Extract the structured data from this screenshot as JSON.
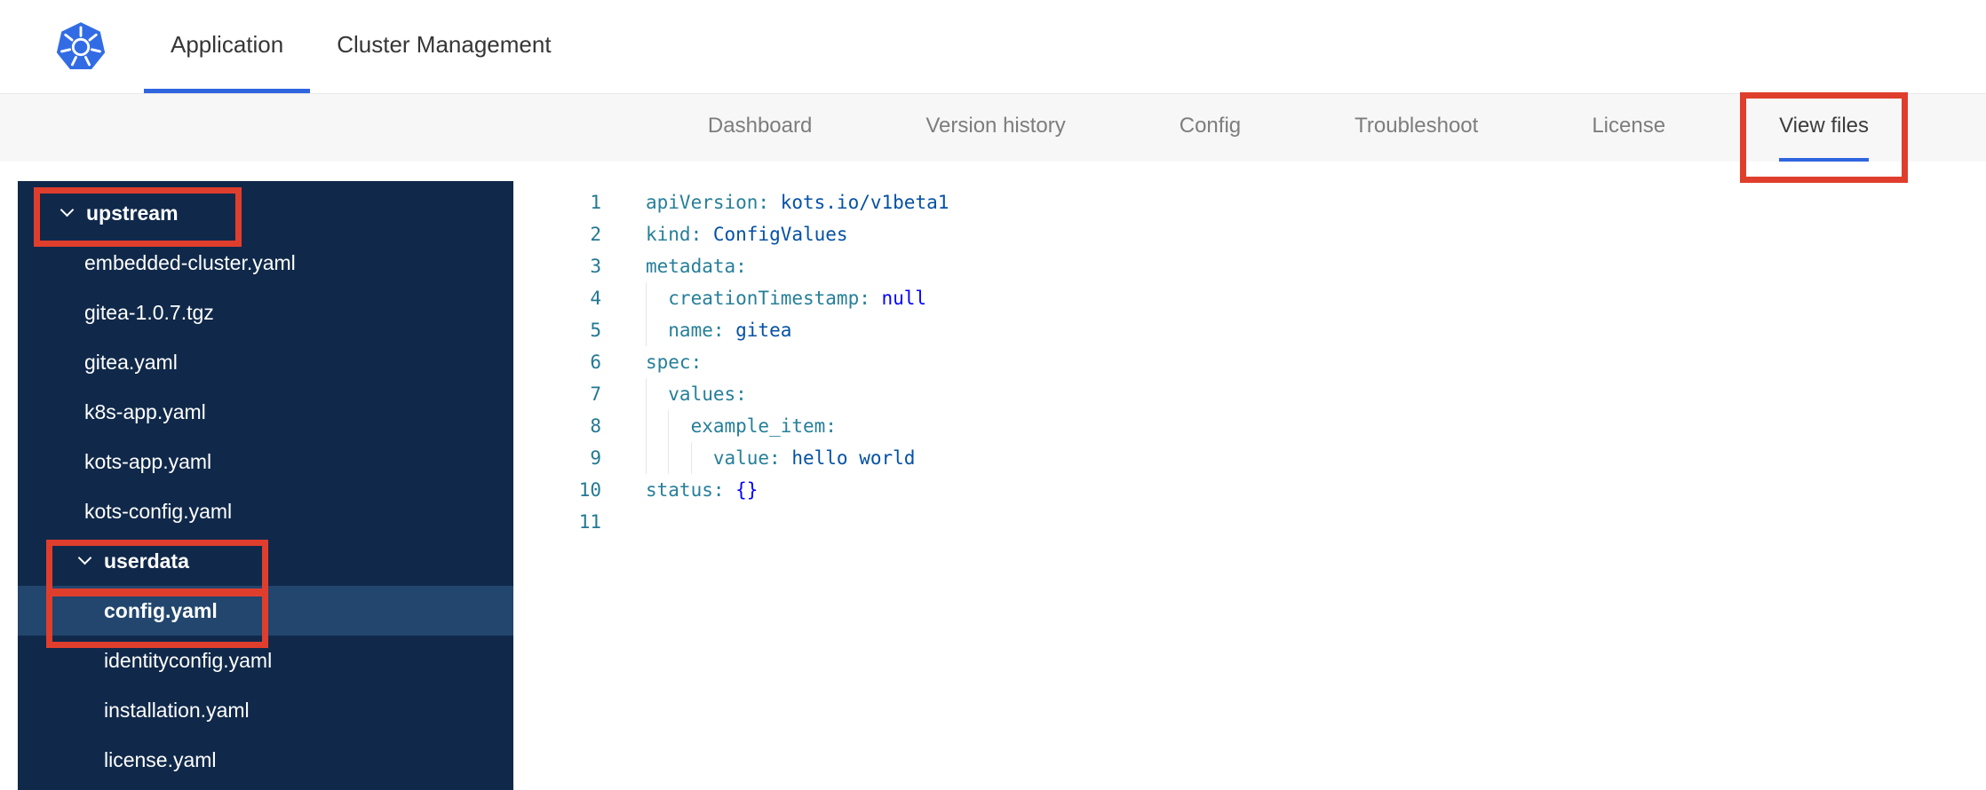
{
  "colors": {
    "annotation_red": "#e03e2d",
    "active_underline_blue": "#3065e0",
    "kubernetes_blue": "#326ce5",
    "sidebar_bg": "#10294a",
    "sidebar_selected_bg": "#22466e",
    "code_key": "#267f99",
    "code_value": "#0451a5",
    "code_keyword": "#0000ff"
  },
  "header": {
    "logo": "kubernetes-logo",
    "tabs": [
      {
        "label": "Application",
        "active": true
      },
      {
        "label": "Cluster Management",
        "active": false
      }
    ]
  },
  "subnav": {
    "items": [
      {
        "label": "Dashboard",
        "active": false,
        "annotated": false
      },
      {
        "label": "Version history",
        "active": false,
        "annotated": false
      },
      {
        "label": "Config",
        "active": false,
        "annotated": false
      },
      {
        "label": "Troubleshoot",
        "active": false,
        "annotated": false
      },
      {
        "label": "License",
        "active": false,
        "annotated": false
      },
      {
        "label": "View files",
        "active": true,
        "annotated": true
      }
    ]
  },
  "file_tree": {
    "items": [
      {
        "type": "folder",
        "label": "upstream",
        "level": 0,
        "expanded": true,
        "selected": false,
        "annotated": true
      },
      {
        "type": "file",
        "label": "embedded-cluster.yaml",
        "level": 1,
        "selected": false,
        "annotated": false
      },
      {
        "type": "file",
        "label": "gitea-1.0.7.tgz",
        "level": 1,
        "selected": false,
        "annotated": false
      },
      {
        "type": "file",
        "label": "gitea.yaml",
        "level": 1,
        "selected": false,
        "annotated": false
      },
      {
        "type": "file",
        "label": "k8s-app.yaml",
        "level": 1,
        "selected": false,
        "annotated": false
      },
      {
        "type": "file",
        "label": "kots-app.yaml",
        "level": 1,
        "selected": false,
        "annotated": false
      },
      {
        "type": "file",
        "label": "kots-config.yaml",
        "level": 1,
        "selected": false,
        "annotated": false
      },
      {
        "type": "folder",
        "label": "userdata",
        "level": 1,
        "expanded": true,
        "selected": false,
        "annotated": true
      },
      {
        "type": "file",
        "label": "config.yaml",
        "level": 2,
        "selected": true,
        "annotated": true
      },
      {
        "type": "file",
        "label": "identityconfig.yaml",
        "level": 2,
        "selected": false,
        "annotated": false
      },
      {
        "type": "file",
        "label": "installation.yaml",
        "level": 2,
        "selected": false,
        "annotated": false
      },
      {
        "type": "file",
        "label": "license.yaml",
        "level": 2,
        "selected": false,
        "annotated": false
      }
    ]
  },
  "editor": {
    "language": "yaml",
    "lines": [
      {
        "num": 1,
        "indent": 0,
        "tokens": [
          [
            "key",
            "apiVersion:"
          ],
          [
            "val",
            " kots.io/v1beta1"
          ]
        ]
      },
      {
        "num": 2,
        "indent": 0,
        "tokens": [
          [
            "key",
            "kind:"
          ],
          [
            "val",
            " ConfigValues"
          ]
        ]
      },
      {
        "num": 3,
        "indent": 0,
        "tokens": [
          [
            "key",
            "metadata:"
          ]
        ]
      },
      {
        "num": 4,
        "indent": 1,
        "tokens": [
          [
            "key",
            "creationTimestamp:"
          ],
          [
            "kw",
            " null"
          ]
        ]
      },
      {
        "num": 5,
        "indent": 1,
        "tokens": [
          [
            "key",
            "name:"
          ],
          [
            "val",
            " gitea"
          ]
        ]
      },
      {
        "num": 6,
        "indent": 0,
        "tokens": [
          [
            "key",
            "spec:"
          ]
        ]
      },
      {
        "num": 7,
        "indent": 1,
        "tokens": [
          [
            "key",
            "values:"
          ]
        ]
      },
      {
        "num": 8,
        "indent": 2,
        "tokens": [
          [
            "key",
            "example_item:"
          ]
        ]
      },
      {
        "num": 9,
        "indent": 3,
        "tokens": [
          [
            "key",
            "value:"
          ],
          [
            "val",
            " hello world"
          ]
        ]
      },
      {
        "num": 10,
        "indent": 0,
        "tokens": [
          [
            "key",
            "status:"
          ],
          [
            "kw",
            " {}"
          ]
        ]
      },
      {
        "num": 11,
        "indent": 0,
        "tokens": []
      }
    ]
  }
}
